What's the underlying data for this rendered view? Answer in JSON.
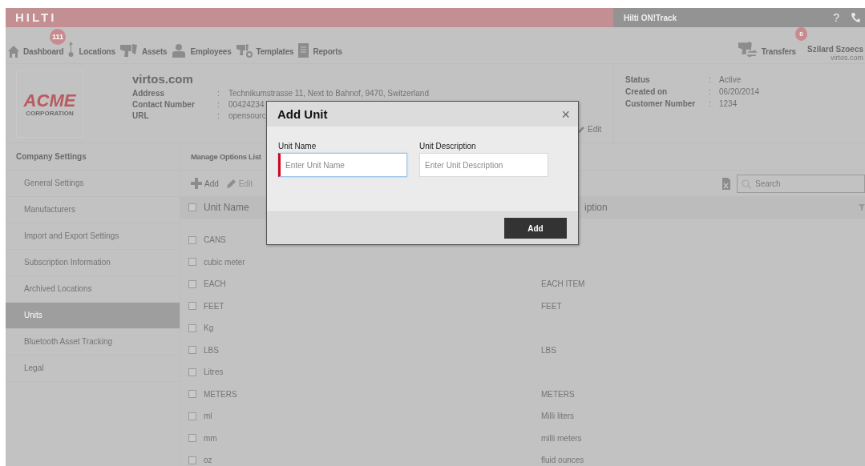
{
  "header": {
    "logo": "HILTI",
    "app_name": "Hilti ON!Track",
    "help": "?"
  },
  "nav": {
    "items": [
      {
        "label": "Dashboard",
        "badge": "111"
      },
      {
        "label": "Locations"
      },
      {
        "label": "Assets"
      },
      {
        "label": "Employees"
      },
      {
        "label": "Templates"
      },
      {
        "label": "Reports"
      }
    ],
    "transfers": {
      "label": "Transfers",
      "badge": "0"
    },
    "user": {
      "name": "Szilard Szoecs",
      "company": "virtos.com"
    }
  },
  "company": {
    "logo": {
      "name": "ACME",
      "sub": "CORPORATION"
    },
    "name": "virtos.com",
    "fields": [
      {
        "label": "Address",
        "separator": ":",
        "value": "Technikumstrasse 11, Next to Bahnof, 9470, Switzerland"
      },
      {
        "label": "Contact Number",
        "separator": ":",
        "value": "00424234"
      },
      {
        "label": "URL",
        "separator": ":",
        "value": "opensourc"
      }
    ],
    "edit": "Edit",
    "status_fields": [
      {
        "label": "Status",
        "separator": ":",
        "value": "Active"
      },
      {
        "label": "Created on",
        "separator": ":",
        "value": "06/20/2014"
      },
      {
        "label": "Customer Number",
        "separator": ":",
        "value": "1234"
      }
    ]
  },
  "sidebar": {
    "title": "Company Settings",
    "items": [
      {
        "label": "General Settings",
        "selected": false
      },
      {
        "label": "Manufacturers",
        "selected": false
      },
      {
        "label": "Import and Export Settings",
        "selected": false
      },
      {
        "label": "Subscription Information",
        "selected": false
      },
      {
        "label": "Archived Locations",
        "selected": false
      },
      {
        "label": "Units",
        "selected": true
      },
      {
        "label": "Bluetooth Asset Tracking",
        "selected": false
      },
      {
        "label": "Legal",
        "selected": false
      }
    ]
  },
  "main": {
    "title": "Manage Options List",
    "toolbar": {
      "add": {
        "label": "Add",
        "disabled": false
      },
      "edit": {
        "label": "Edit",
        "disabled": true
      },
      "search_placeholder": "Search"
    },
    "table": {
      "all_checked": false,
      "columns": [
        "Unit Name",
        "iption"
      ],
      "rows": [
        {
          "checked": false,
          "cells": [
            "CANS",
            ""
          ]
        },
        {
          "checked": false,
          "cells": [
            "cubic meter",
            ""
          ]
        },
        {
          "checked": false,
          "cells": [
            "EACH",
            "EACH ITEM"
          ]
        },
        {
          "checked": false,
          "cells": [
            "FEET",
            "FEET"
          ]
        },
        {
          "checked": false,
          "cells": [
            "Kg",
            ""
          ]
        },
        {
          "checked": false,
          "cells": [
            "LBS",
            "LBS"
          ]
        },
        {
          "checked": false,
          "cells": [
            "Litres",
            ""
          ]
        },
        {
          "checked": false,
          "cells": [
            "METERS",
            "METERS"
          ]
        },
        {
          "checked": false,
          "cells": [
            "ml",
            "Milli liters"
          ]
        },
        {
          "checked": false,
          "cells": [
            "mm",
            "milli meters"
          ]
        },
        {
          "checked": false,
          "cells": [
            "oz",
            "fluid ounces"
          ]
        }
      ]
    }
  },
  "dialog": {
    "title": "Add Unit",
    "close": "×",
    "fields": [
      {
        "label": "Unit Name",
        "placeholder": "Enter Unit Name",
        "focused": true
      },
      {
        "label": "Unit Description",
        "placeholder": "Enter Unit Description",
        "focused": false
      }
    ],
    "submit": "Add"
  }
}
